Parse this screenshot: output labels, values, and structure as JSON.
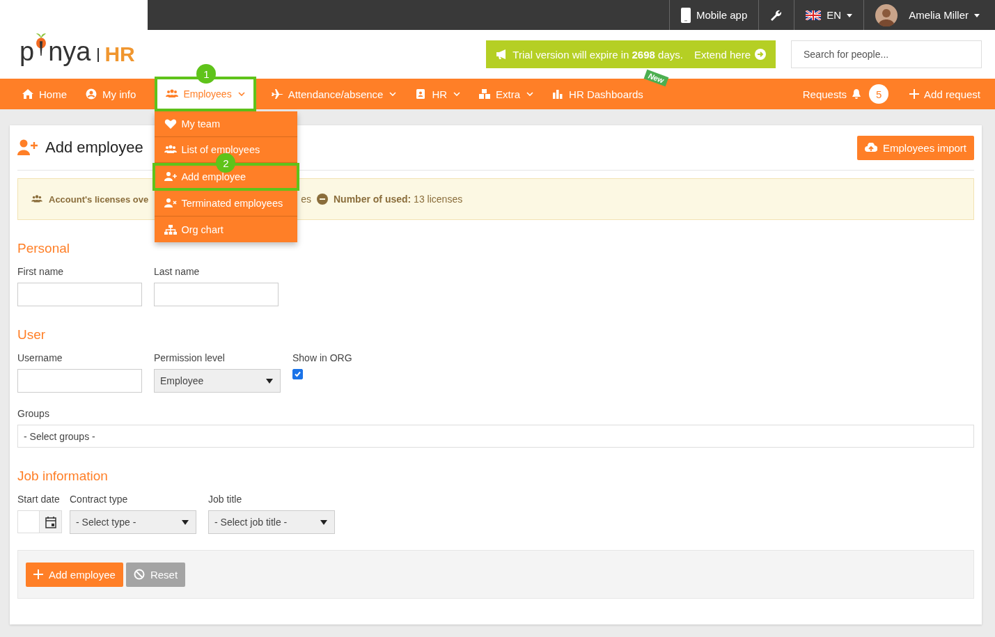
{
  "logo": {
    "left": "p",
    "right": "nya",
    "product": "HR"
  },
  "topbar": {
    "mobile_app": "Mobile app",
    "language": "EN",
    "user": "Amelia Miller"
  },
  "trial": {
    "text": "Trial version will expire in **2698** days.",
    "link": "Extend here"
  },
  "search": {
    "placeholder": "Search for people..."
  },
  "nav": [
    {
      "label": "Home",
      "caret": false,
      "selected": false
    },
    {
      "label": "My info",
      "caret": false,
      "selected": false
    },
    {
      "label": "Employees",
      "caret": true,
      "selected": true,
      "step": "1"
    },
    {
      "label": "Attendance/absence",
      "caret": true,
      "selected": false
    },
    {
      "label": "HR",
      "caret": true,
      "selected": false
    },
    {
      "label": "Extra",
      "caret": true,
      "selected": false
    },
    {
      "label": "HR Dashboards",
      "caret": false,
      "selected": false,
      "badge": "New"
    }
  ],
  "requests": {
    "label": "Requests",
    "count": "5"
  },
  "add_request": "Add request",
  "dropdown": [
    {
      "label": "My team",
      "selected": false
    },
    {
      "label": "List of employees",
      "selected": false
    },
    {
      "label": "Add employee",
      "selected": true,
      "step": "2"
    },
    {
      "label": "Terminated employees",
      "selected": false
    },
    {
      "label": "Org chart",
      "selected": false
    }
  ],
  "page": {
    "title": "Add employee",
    "import_button": "Employees import"
  },
  "licenses": {
    "left": "Account's licenses ove",
    "fragment": "es",
    "used_label": "Number of used:",
    "used_value": "13 licenses"
  },
  "personal": {
    "heading": "Personal",
    "fields": [
      {
        "label": "First name"
      },
      {
        "label": "Last name"
      }
    ]
  },
  "user": {
    "heading": "User",
    "username": "Username",
    "permission": {
      "label": "Permission level",
      "value": "Employee"
    },
    "show_in_org": {
      "label": "Show in ORG",
      "checked": true
    },
    "groups": {
      "label": "Groups",
      "value": "- Select groups -"
    }
  },
  "job": {
    "heading": "Job information",
    "start_date": "Start date",
    "contract": {
      "label": "Contract type",
      "value": "- Select type -"
    },
    "job_title": {
      "label": "Job title",
      "value": "- Select job title -"
    }
  },
  "actions": {
    "submit": "Add employee",
    "reset": "Reset"
  }
}
